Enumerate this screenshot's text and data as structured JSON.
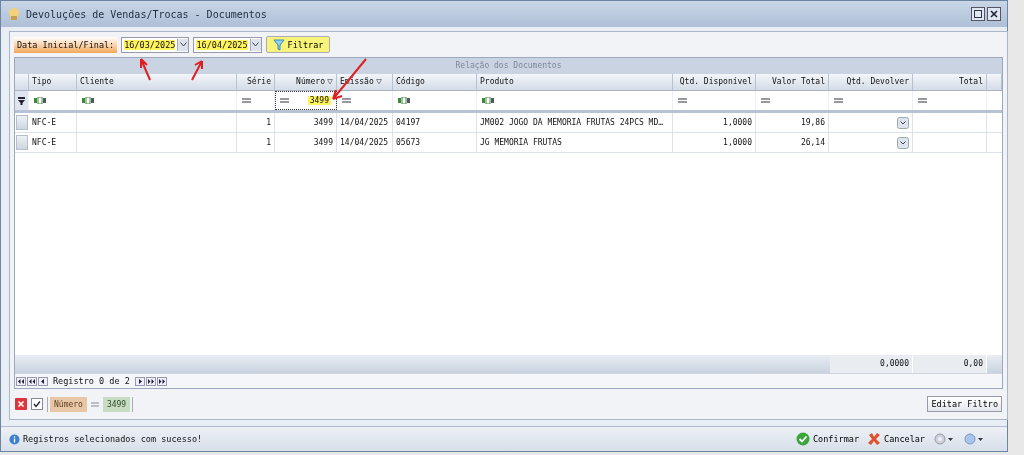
{
  "window": {
    "title": "Devoluções de Vendas/Trocas - Documentos"
  },
  "date_filter": {
    "label": "Data Inicial/Final:",
    "start": "16/03/2025",
    "end": "16/04/2025",
    "button": "Filtrar"
  },
  "grid": {
    "caption": "Relação dos Documentos",
    "columns": [
      {
        "label": "Tipo",
        "filter_icon": false
      },
      {
        "label": "Cliente",
        "filter_icon": false
      },
      {
        "label": "Série",
        "filter_icon": false
      },
      {
        "label": "Número",
        "filter_icon": true
      },
      {
        "label": "Emissão",
        "filter_icon": true
      },
      {
        "label": "Código",
        "filter_icon": false
      },
      {
        "label": "Produto",
        "filter_icon": false
      },
      {
        "label": "Qtd. Disponível",
        "filter_icon": false
      },
      {
        "label": "Valor Total",
        "filter_icon": false
      },
      {
        "label": "Qtd. Devolver",
        "filter_icon": false
      },
      {
        "label": "Total",
        "filter_icon": false
      }
    ],
    "filter_row": [
      {
        "kind": "text"
      },
      {
        "kind": "text"
      },
      {
        "kind": "number"
      },
      {
        "kind": "number",
        "value": "3499"
      },
      {
        "kind": "number"
      },
      {
        "kind": "text"
      },
      {
        "kind": "text"
      },
      {
        "kind": "number"
      },
      {
        "kind": "number"
      },
      {
        "kind": "number"
      },
      {
        "kind": "number"
      }
    ],
    "rows": [
      {
        "cells": [
          "NFC-E",
          "",
          "1",
          "3499",
          "14/04/2025",
          "04197",
          "JM002 JOGO DA MEMORIA FRUTAS 24PCS MD…",
          "1,0000",
          "19,86",
          "",
          ""
        ]
      },
      {
        "cells": [
          "NFC-E",
          "",
          "1",
          "3499",
          "14/04/2025",
          "05673",
          "JG MEMORIA FRUTAS",
          "1,0000",
          "26,14",
          "",
          ""
        ]
      }
    ],
    "totals": {
      "qtd_devolver": "0,0000",
      "total": "0,00"
    },
    "pager": "Registro 0 de 2",
    "filter_bar": {
      "enabled": true,
      "field": "Número",
      "value": "3499",
      "button": "Editar Filtro"
    }
  },
  "status": {
    "message": "Registros selecionados com sucesso!"
  },
  "buttons": [
    {
      "kind": "confirm",
      "label": "Confirmar"
    },
    {
      "kind": "cancel",
      "label": "Cancelar"
    }
  ]
}
